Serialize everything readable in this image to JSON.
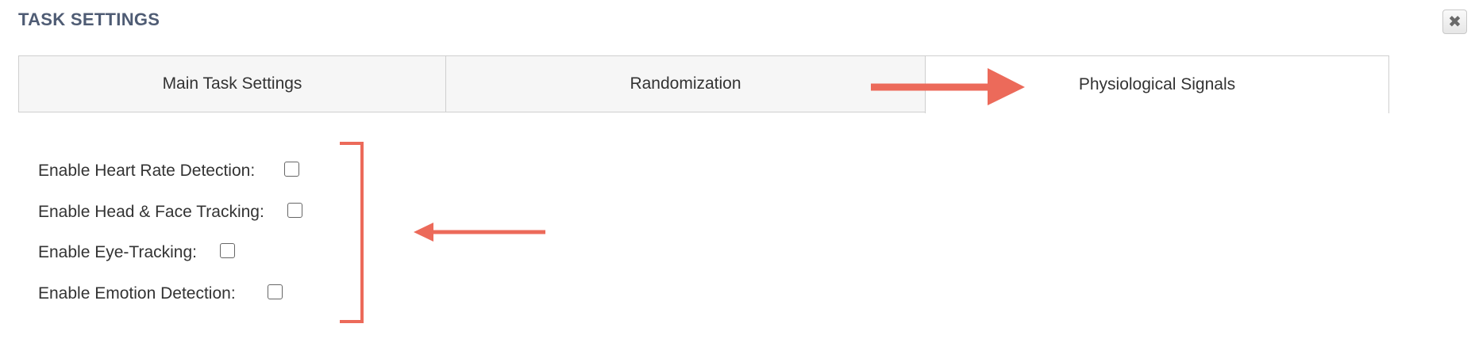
{
  "dialog": {
    "title": "TASK SETTINGS",
    "close_icon": "close-icon",
    "close_glyph": "✖"
  },
  "tabs": [
    {
      "label": "Main Task Settings",
      "active": false
    },
    {
      "label": "Randomization",
      "active": false
    },
    {
      "label": "Physiological Signals",
      "active": true
    }
  ],
  "options": [
    {
      "label": "Enable Heart Rate Detection:",
      "checked": false
    },
    {
      "label": "Enable Head & Face Tracking:",
      "checked": false
    },
    {
      "label": "Enable Eye-Tracking:",
      "checked": false
    },
    {
      "label": "Enable Emotion Detection:",
      "checked": false
    }
  ],
  "annotation_color": "#ec6a5a",
  "colors": {
    "title": "#4f5c74",
    "text": "#333333",
    "tab_bg": "#f6f6f6",
    "border": "#cfcfcf"
  }
}
